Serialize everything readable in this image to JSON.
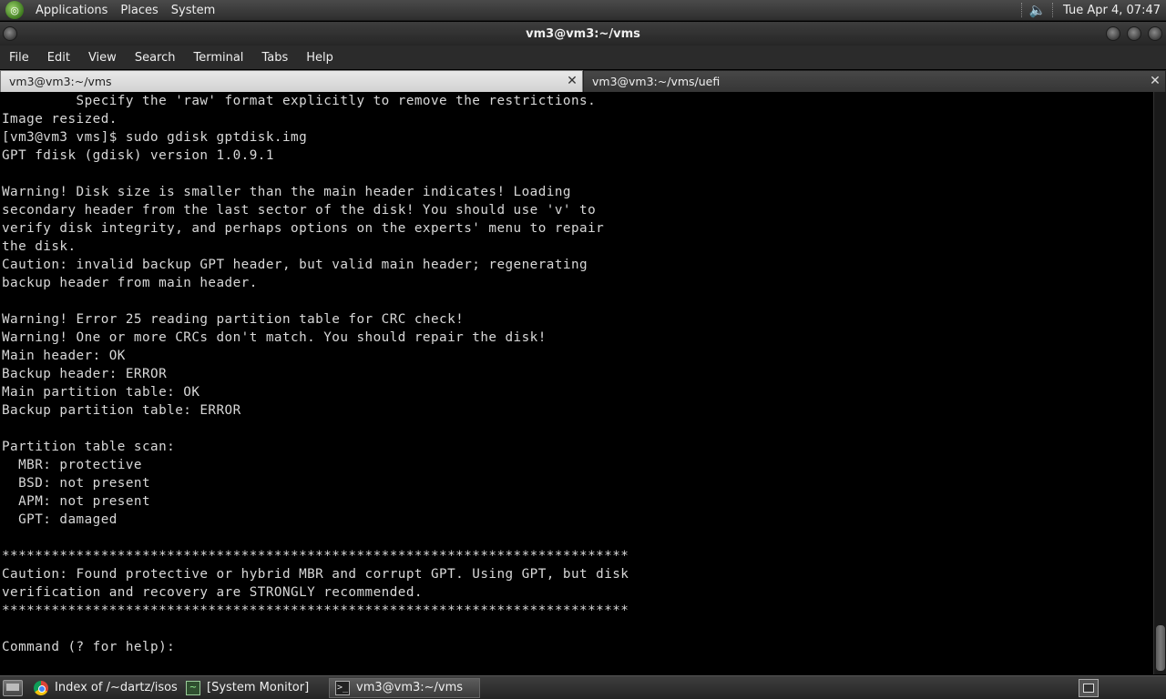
{
  "top_panel": {
    "menus": [
      "Applications",
      "Places",
      "System"
    ],
    "clock": "Tue Apr  4, 07:47"
  },
  "window": {
    "title": "vm3@vm3:~/vms"
  },
  "menubar": {
    "items": [
      "File",
      "Edit",
      "View",
      "Search",
      "Terminal",
      "Tabs",
      "Help"
    ]
  },
  "tabs": [
    {
      "label": "vm3@vm3:~/vms",
      "active": true
    },
    {
      "label": "vm3@vm3:~/vms/uefi",
      "active": false
    }
  ],
  "terminal": {
    "lines": [
      "         Specify the 'raw' format explicitly to remove the restrictions.",
      "Image resized.",
      "[vm3@vm3 vms]$ sudo gdisk gptdisk.img",
      "GPT fdisk (gdisk) version 1.0.9.1",
      "",
      "Warning! Disk size is smaller than the main header indicates! Loading",
      "secondary header from the last sector of the disk! You should use 'v' to",
      "verify disk integrity, and perhaps options on the experts' menu to repair",
      "the disk.",
      "Caution: invalid backup GPT header, but valid main header; regenerating",
      "backup header from main header.",
      "",
      "Warning! Error 25 reading partition table for CRC check!",
      "Warning! One or more CRCs don't match. You should repair the disk!",
      "Main header: OK",
      "Backup header: ERROR",
      "Main partition table: OK",
      "Backup partition table: ERROR",
      "",
      "Partition table scan:",
      "  MBR: protective",
      "  BSD: not present",
      "  APM: not present",
      "  GPT: damaged",
      "",
      "****************************************************************************",
      "Caution: Found protective or hybrid MBR and corrupt GPT. Using GPT, but disk",
      "verification and recovery are STRONGLY recommended.",
      "****************************************************************************",
      "",
      "Command (? for help): "
    ]
  },
  "taskbar": {
    "tasks": [
      {
        "label": "Index of /~dartz/isos…",
        "icon": "chrome-icon",
        "active": false
      },
      {
        "label": "[System Monitor]",
        "icon": "system-monitor-icon",
        "active": false
      },
      {
        "label": "vm3@vm3:~/vms",
        "icon": "terminal-icon",
        "active": true
      }
    ]
  }
}
